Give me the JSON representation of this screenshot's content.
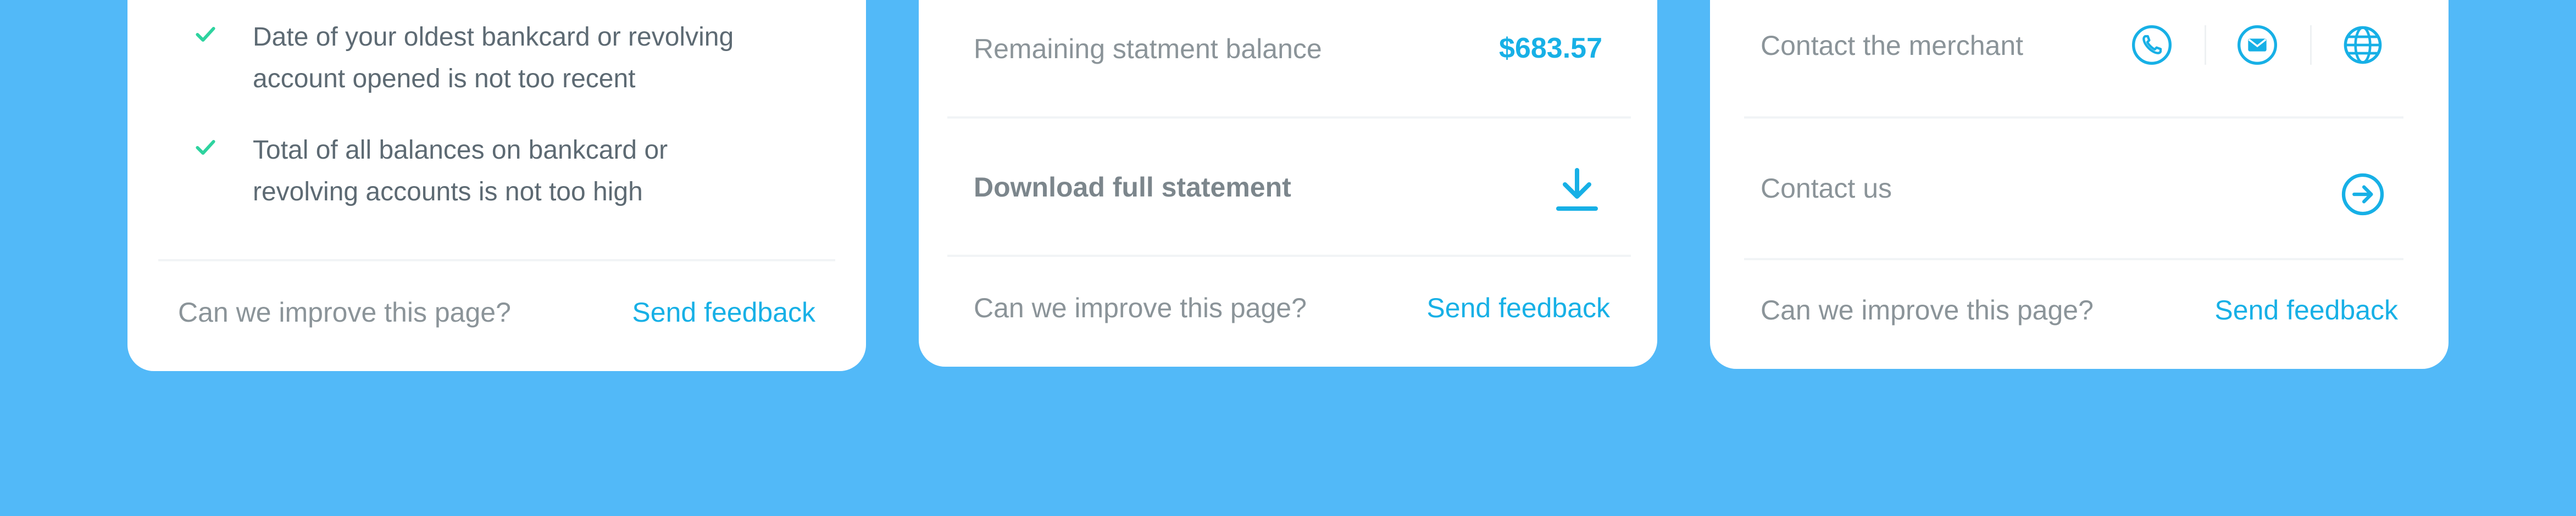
{
  "colors": {
    "background": "#52b9f8",
    "card": "#ffffff",
    "accent": "#17b0e6",
    "check": "#2ed39f",
    "muted_text": "#8b9499"
  },
  "card1": {
    "checks": [
      {
        "text": "Date of your oldest bankcard or revolving account opened is not too recent",
        "icon": "check-icon"
      },
      {
        "text": "Total of all balances on bankcard or revolving accounts is not too high",
        "icon": "check-icon"
      }
    ],
    "footer": {
      "question": "Can we improve this page?",
      "link": "Send feedback"
    }
  },
  "card2": {
    "remaining": {
      "label": "Remaining statment balance",
      "value": "$683.57"
    },
    "download": {
      "label": "Download full statement",
      "icon": "download-icon"
    },
    "footer": {
      "question": "Can we improve this page?",
      "link": "Send feedback"
    }
  },
  "card3": {
    "merchant": {
      "label": "Contact the merchant",
      "icons": [
        "phone-icon",
        "mail-icon",
        "globe-icon"
      ]
    },
    "contact_us": {
      "label": "Contact us",
      "icon": "arrow-right-circle-icon"
    },
    "footer": {
      "question": "Can we improve this page?",
      "link": "Send feedback"
    }
  }
}
